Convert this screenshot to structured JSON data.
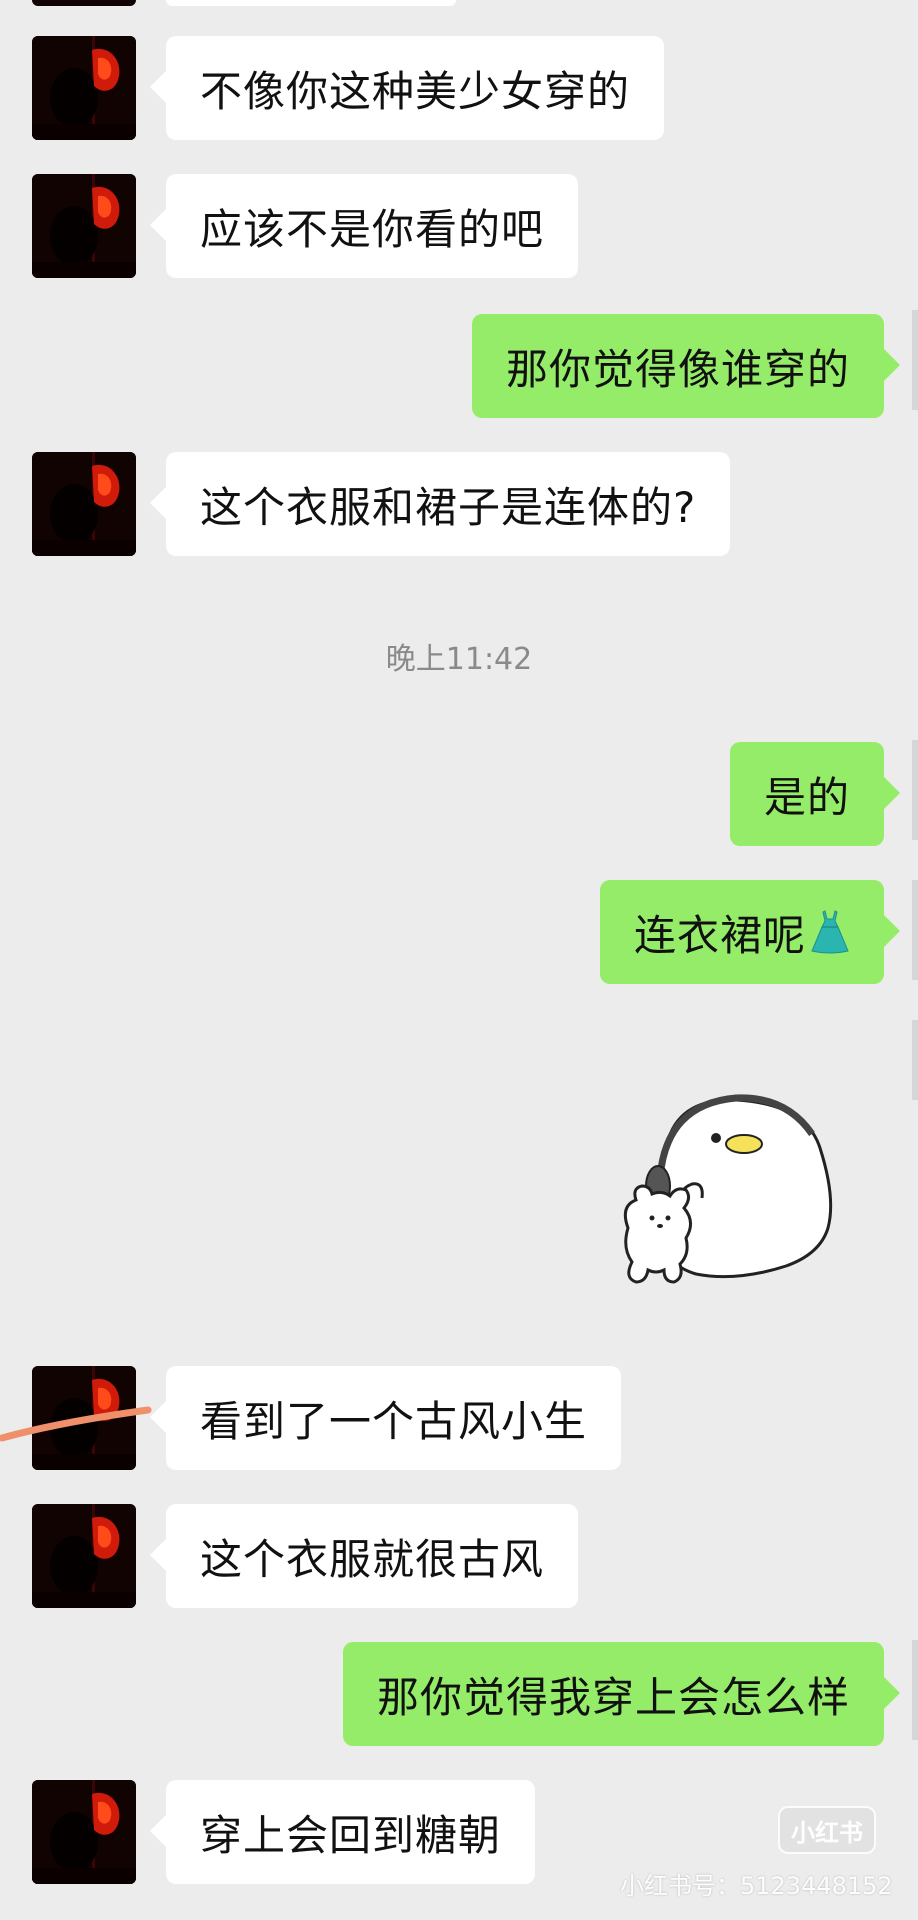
{
  "timestamp": "晚上11:42",
  "messages": [
    {
      "side": "in",
      "text": "不像你这种美少女穿的"
    },
    {
      "side": "in",
      "text": "应该不是你看的吧"
    },
    {
      "side": "out",
      "text": "那你觉得像谁穿的"
    },
    {
      "side": "in",
      "text": "这个衣服和裙子是连体的?"
    },
    {
      "side": "out",
      "text": "是的"
    },
    {
      "side": "out",
      "text": "连衣裙呢",
      "emoji": "dress-icon"
    },
    {
      "side": "out",
      "sticker": "duck-with-headphones-and-bear-sticker"
    },
    {
      "side": "in",
      "text": "看到了一个古风小生"
    },
    {
      "side": "in",
      "text": "这个衣服就很古风"
    },
    {
      "side": "out",
      "text": "那你觉得我穿上会怎么样"
    },
    {
      "side": "in",
      "text": "穿上会回到糖朝"
    }
  ],
  "watermark": {
    "logo_text": "小红书",
    "id_text": "小红书号：5123448152"
  },
  "colors": {
    "background": "#ececec",
    "incoming_bubble": "#ffffff",
    "outgoing_bubble": "#95ec69",
    "avatar_accent": "#d01a0a",
    "annotation_stroke": "#f0906a"
  }
}
